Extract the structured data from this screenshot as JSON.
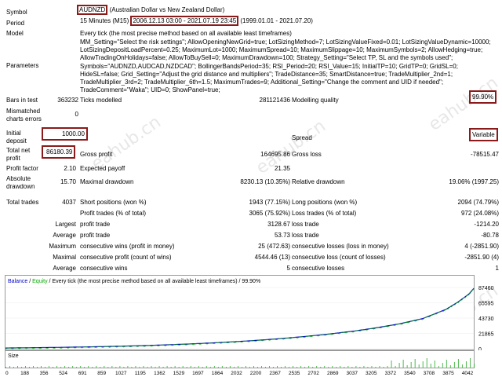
{
  "labels": {
    "symbol": "Symbol",
    "period": "Period",
    "model": "Model",
    "parameters": "Parameters",
    "bars_in_test": "Bars in test",
    "mismatched": "Mismatched charts errors",
    "initial_deposit": "Initial deposit",
    "total_net_profit": "Total net profit",
    "profit_factor": "Profit factor",
    "absolute_drawdown": "Absolute drawdown",
    "total_trades": "Total trades"
  },
  "symbol": {
    "code": "AUDNZD",
    "name": "(Australian Dollar vs New Zealand Dollar)"
  },
  "period": {
    "prefix": "15 Minutes (M15)",
    "range": "2006.12.13 03:00 - 2021.07.19 23:45",
    "suffix": "(1999.01.01 - 2021.07.20)"
  },
  "model": "Every tick (the most precise method based on all available least timeframes)",
  "parameters": "MM_Setting=\"Select the risk settings\"; AllowOpeningNewGrid=true; LotSizingMethod=7; LotSizingValueFixed=0.01; LotSizingValueDynamic=10000; LotSizingDepositLoadPercent=0.25; MaximumLot=1000; MaximumSpread=10; MaximumSlippage=10; MaximumSymbols=2; AllowHedging=true; AllowTradingOnHolidays=false; AllowToBuySell=0; MaximumDrawdown=100; Strategy_Setting=\"Select TP, SL and the symbols used\"; Symbols=\"AUDNZD,AUDCAD,NZDCAD\"; BollingerBandsPeriod=35; RSI_Period=20; RSI_Value=15; InitialTP=10; GridTP=0; GridSL=0; HideSL=false; Grid_Setting=\"Adjust the grid distance and multipliers\"; TradeDistance=35; SmartDistance=true; TradeMultiplier_2nd=1; TradeMultiplier_3rd=2; TradeMultiplier_6th=1.5; MaximumTrades=9; Additional_Setting=\"Change the comment and UID if needed\"; TradeComment=\"Waka\"; UID=0; ShowPanel=true;",
  "stats": {
    "bars_in_test": "363232",
    "ticks_modelled_label": "Ticks modelled",
    "ticks_modelled": "281121436",
    "modelling_quality_label": "Modelling quality",
    "modelling_quality": "99.90%",
    "mismatched": "0",
    "initial_deposit": "1000.00",
    "spread_label": "Spread",
    "spread": "Variable",
    "total_net_profit": "86180.39",
    "gross_profit_label": "Gross profit",
    "gross_profit": "164695.86",
    "gross_loss_label": "Gross loss",
    "gross_loss": "-78515.47",
    "profit_factor": "2.10",
    "expected_payoff_label": "Expected payoff",
    "expected_payoff": "21.35",
    "absolute_drawdown": "15.70",
    "maximal_drawdown_label": "Maximal drawdown",
    "maximal_drawdown": "8230.13 (10.35%)",
    "relative_drawdown_label": "Relative drawdown",
    "relative_drawdown": "19.06% (1997.25)",
    "total_trades": "4037",
    "short_positions_label": "Short positions (won %)",
    "short_positions": "1943 (77.15%)",
    "long_positions_label": "Long positions (won %)",
    "long_positions": "2094 (74.79%)",
    "profit_trades_label": "Profit trades (% of total)",
    "profit_trades": "3065 (75.92%)",
    "loss_trades_label": "Loss trades (% of total)",
    "loss_trades": "972 (24.08%)",
    "largest_label": "Largest",
    "largest_profit_label": "profit trade",
    "largest_profit": "3128.67",
    "largest_loss_label": "loss trade",
    "largest_loss": "-1214.20",
    "average_label": "Average",
    "average_profit_label": "profit trade",
    "average_profit": "53.73",
    "average_loss_label": "loss trade",
    "average_loss": "-80.78",
    "maximum_label": "Maximum",
    "max_cons_wins_label": "consecutive wins (profit in money)",
    "max_cons_wins": "25 (472.63)",
    "max_cons_losses_label": "consecutive losses (loss in money)",
    "max_cons_losses": "4 (-2851.90)",
    "maximal_label": "Maximal",
    "maximal_cons_profit_label": "consecutive profit (count of wins)",
    "maximal_cons_profit": "4544.46 (13)",
    "maximal_cons_loss_label": "consecutive loss (count of losses)",
    "maximal_cons_loss": "-2851.90 (4)",
    "avg_cons_wins_label": "consecutive wins",
    "avg_cons_wins": "5",
    "avg_cons_losses_label": "consecutive losses",
    "avg_cons_losses": "1"
  },
  "watermark": "eahub.cn",
  "chart_data": {
    "type": "line",
    "legend": {
      "balance": "Balance",
      "sep": " / ",
      "equity": "Equity",
      "desc": " / Every tick (the most precise method based on all available least timeframes) / 99.90%"
    },
    "series": [
      {
        "name": "Balance",
        "color": "#0000cc"
      },
      {
        "name": "Equity",
        "color": "#00aa00"
      }
    ],
    "y_ticks": [
      "87460",
      "65595",
      "43730",
      "21865",
      "0"
    ],
    "y_range": [
      0,
      87460
    ],
    "x_ticks": [
      "0",
      "188",
      "356",
      "524",
      "691",
      "859",
      "1027",
      "1195",
      "1362",
      "1529",
      "1697",
      "1864",
      "2032",
      "2200",
      "2367",
      "2535",
      "2702",
      "2869",
      "3037",
      "3205",
      "3372",
      "3540",
      "3708",
      "3875",
      "4042"
    ],
    "x_range": [
      0,
      4042
    ],
    "balance_points": [
      [
        0,
        1000
      ],
      [
        200,
        1400
      ],
      [
        400,
        1800
      ],
      [
        600,
        2300
      ],
      [
        800,
        2900
      ],
      [
        1000,
        3600
      ],
      [
        1200,
        4500
      ],
      [
        1400,
        5600
      ],
      [
        1600,
        6900
      ],
      [
        1800,
        8400
      ],
      [
        2000,
        10200
      ],
      [
        2200,
        12300
      ],
      [
        2400,
        14800
      ],
      [
        2600,
        17700
      ],
      [
        2800,
        21100
      ],
      [
        3000,
        25000
      ],
      [
        3200,
        29800
      ],
      [
        3400,
        35500
      ],
      [
        3600,
        43000
      ],
      [
        3800,
        56000
      ],
      [
        3900,
        66000
      ],
      [
        4000,
        78000
      ],
      [
        4042,
        86180
      ]
    ],
    "size_label": "Size"
  }
}
